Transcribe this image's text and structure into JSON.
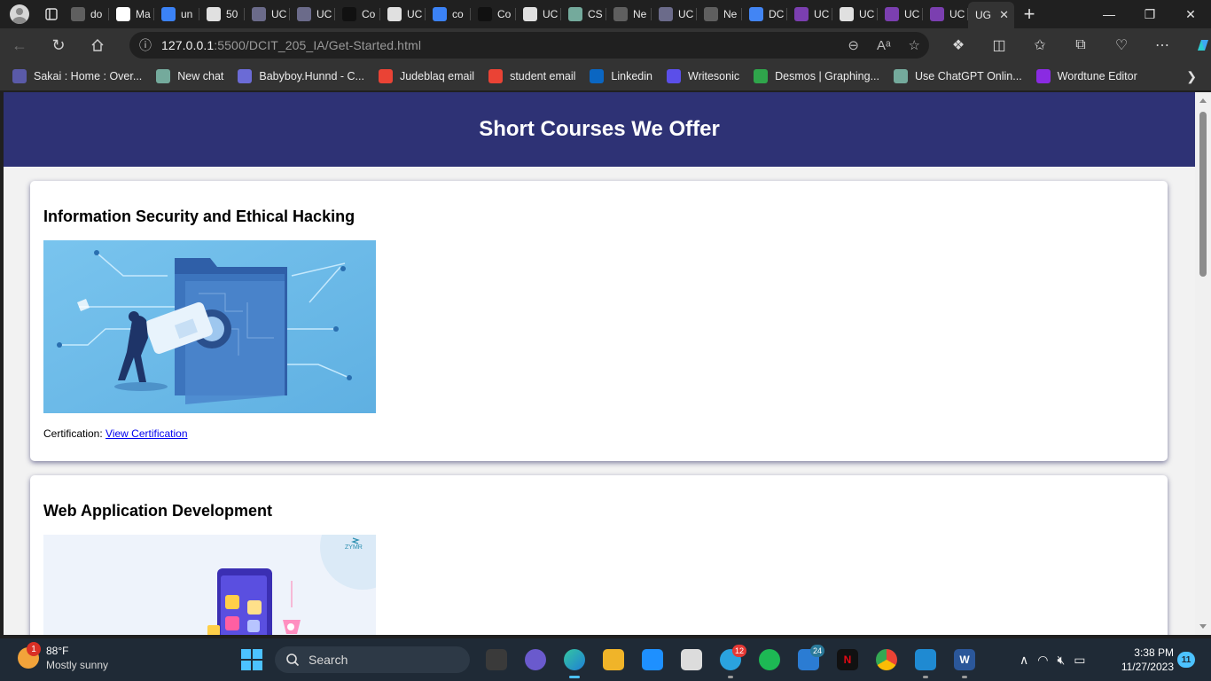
{
  "browser": {
    "tabs": [
      {
        "title": "do",
        "icon": "file-x-icon",
        "color": "#5f5f5f"
      },
      {
        "title": "Ma",
        "icon": "github-icon",
        "color": "#ffffff"
      },
      {
        "title": "un",
        "icon": "search-icon",
        "color": "#3b82f6"
      },
      {
        "title": "50",
        "icon": "file-icon",
        "color": "#e0e0e0"
      },
      {
        "title": "UC",
        "icon": "ug-shield-icon",
        "color": "#6b6b8a"
      },
      {
        "title": "UC",
        "icon": "ug-shield-icon",
        "color": "#6b6b8a"
      },
      {
        "title": "Co",
        "icon": "coursera-icon",
        "color": "#111111"
      },
      {
        "title": "UC",
        "icon": "file-icon",
        "color": "#e0e0e0"
      },
      {
        "title": "co",
        "icon": "search-icon",
        "color": "#3b82f6"
      },
      {
        "title": "Co",
        "icon": "coursera-icon",
        "color": "#111111"
      },
      {
        "title": "UC",
        "icon": "file-icon",
        "color": "#e0e0e0"
      },
      {
        "title": "CS",
        "icon": "chatgpt-icon",
        "color": "#74aa9c"
      },
      {
        "title": "Ne",
        "icon": "newtab-icon",
        "color": "#5f5f5f"
      },
      {
        "title": "UC",
        "icon": "ug-shield-icon",
        "color": "#6b6b8a"
      },
      {
        "title": "Ne",
        "icon": "newtab-icon",
        "color": "#5f5f5f"
      },
      {
        "title": "DC",
        "icon": "docs-icon",
        "color": "#4285f4"
      },
      {
        "title": "UC",
        "icon": "ug-shield-icon",
        "color": "#7b3fb0"
      },
      {
        "title": "UC",
        "icon": "file-icon",
        "color": "#e0e0e0"
      },
      {
        "title": "UC",
        "icon": "ug-shield-icon",
        "color": "#7b3fb0"
      },
      {
        "title": "UC",
        "icon": "ug-shield-icon",
        "color": "#7b3fb0"
      },
      {
        "title": "UG",
        "icon": "none",
        "color": "#333333",
        "active": true
      }
    ],
    "url_host": "127.0.0.1",
    "url_path": ":5500/DCIT_205_IA/Get-Started.html",
    "favorites": [
      {
        "label": "Sakai : Home : Over...",
        "icon": "sakai-icon",
        "color": "#5a5aa8"
      },
      {
        "label": "New chat",
        "icon": "chatgpt-icon",
        "color": "#74aa9c"
      },
      {
        "label": "Babyboy.Hunnd - C...",
        "icon": "code-icon",
        "color": "#6b6bd6"
      },
      {
        "label": "Judeblaq email",
        "icon": "gmail-icon",
        "color": "#ea4335"
      },
      {
        "label": "student email",
        "icon": "gmail-icon",
        "color": "#ea4335"
      },
      {
        "label": "Linkedin",
        "icon": "linkedin-icon",
        "color": "#0a66c2"
      },
      {
        "label": "Writesonic",
        "icon": "writesonic-icon",
        "color": "#5b4fe9"
      },
      {
        "label": "Desmos | Graphing...",
        "icon": "desmos-icon",
        "color": "#2fa54b"
      },
      {
        "label": "Use ChatGPT Onlin...",
        "icon": "chatgpt-icon",
        "color": "#74aa9c"
      },
      {
        "label": "Wordtune Editor",
        "icon": "wordtune-icon",
        "color": "#8a2be2"
      }
    ]
  },
  "page": {
    "header_title": "Short Courses We Offer",
    "courses": [
      {
        "title": "Information Security and Ethical Hacking",
        "cert_label": "Certification:",
        "cert_link": "View Certification"
      },
      {
        "title": "Web Application Development",
        "image_caption": "ZYMR"
      }
    ]
  },
  "taskbar": {
    "weather_temp": "88°F",
    "weather_cond": "Mostly sunny",
    "weather_badge": "1",
    "search_label": "Search",
    "telegram_count": "12",
    "mail_count": "24",
    "time": "3:38 PM",
    "date": "11/27/2023",
    "notifications": "11"
  }
}
